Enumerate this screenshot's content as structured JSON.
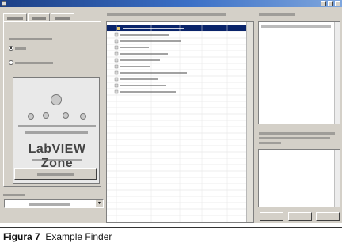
{
  "zone": {
    "title": "LabVIEW Zone"
  },
  "caption": {
    "number": "Figura 7",
    "text": "Example Finder"
  },
  "colors": {
    "titlebar_start": "#1c3f86",
    "titlebar_end": "#7fa6dd",
    "window_face": "#d4d0c8",
    "list_background": "#ffffff"
  }
}
